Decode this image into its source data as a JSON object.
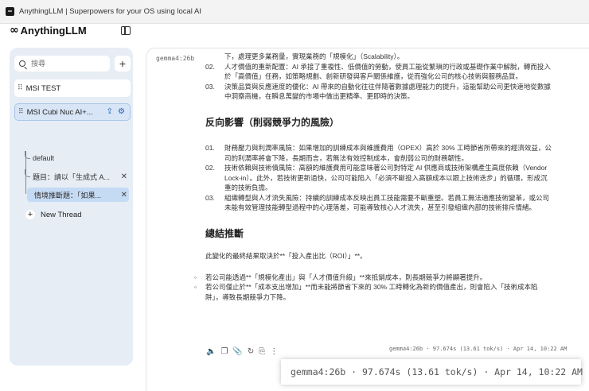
{
  "window": {
    "title": "AnythingLLM | Superpowers for your OS using local AI",
    "icon": "anythingllm-app-icon"
  },
  "sidebar": {
    "brand": {
      "logo": "anythingllm-logo-icon",
      "name": "AnythingLLM"
    },
    "search": {
      "placeholder": "搜尋"
    },
    "workspaces": [
      {
        "label": "MSI TEST"
      },
      {
        "label": "MSI Cubi Nuc AI+..."
      }
    ],
    "threads": [
      {
        "label": "default"
      },
      {
        "label": "題目：請以「生成式 A..."
      },
      {
        "label": "情境推斷題：「如果..."
      }
    ],
    "new_thread_label": "New Thread"
  },
  "chat": {
    "model": "gemma4:26b",
    "lines": [
      "下，處理更多業務量，實現業務的「規模化」（Scalability）。",
      "人才價值的重新配置：AI 承接了重複性、低價值的勞動，使員工能從繁瑣的行政或基礎作業中解脫，轉而投入",
      "於「高價值」任務，如策略規劃、創新研發與客戶關係維護，從而強化公司的核心技術與服務品質。",
      "決策品質與反應速度的優化：AI 帶來的自動化往往伴隨著數據處理能力的提升，這能幫助公司更快速地從數據",
      "中洞察商機，在瞬息萬變的市場中做出更精準、更即時的決策。"
    ],
    "nums_top": [
      "02.",
      "03."
    ],
    "heading1": "反向影響（削弱競爭力的風險）",
    "risk_lines": [
      "財務壓力與利潤率風險：如果增加的訓練成本與維護費用（OPEX）高於 30% 工時節省所帶來的經濟效益，公",
      "司的利潤率將會下降，長期而言，若無法有效控制成本，會削弱公司的財務韌性。",
      "技術依賴與技術債風險：高額的維護費用可能意味著公司對特定 AI 供應商或技術架構產生高度依賴（Vendor",
      "Lock-in）。此外，若技術更新過快，公司可能陷入「必須不斷投入高額成本以跟上技術迭步」的循環，形成沉",
      "重的技術負擔。",
      "組織轉型與人才流失風險：持續的訓練成本反映出員工技能需要不斷重塑。若員工無法適應技術變革，或公司",
      "未能有效管理技能轉型過程中的心理落差，可能導致核心人才流失，甚至引發組織內部的技術排斥情緒。"
    ],
    "nums_risk": [
      "01.",
      "02.",
      "03."
    ],
    "heading2": "總結推斷",
    "summary_intro": "此變化的最終結果取決於**「投入產出比（ROI）」**。",
    "summary_bullets": [
      "若公司能透過**「規模化產出」與「人才價值升級」**來抵銷成本，則長期競爭力將顯著提升。",
      "若公司僅止於**「成本支出增加」**而未能將節省下來的 30% 工時轉化為新的價值產出，則會陷入「技術成本陷",
      "阱」，導致長期競爭力下降。"
    ],
    "meta": "gemma4:26b · 97.674s (13.61 tok/s) · Apr 14, 10:22 AM"
  },
  "zoom": {
    "text": "gemma4:26b · 97.674s (13.61 tok/s) · Apr 14, 10:22 AM"
  }
}
